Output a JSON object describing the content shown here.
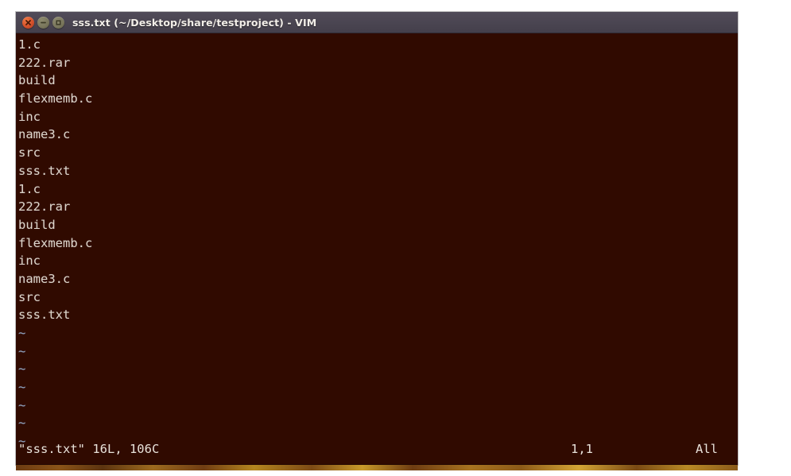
{
  "window": {
    "title": "sss.txt (~/Desktop/share/testproject) - VIM",
    "controls": [
      {
        "name": "close",
        "label": "Close",
        "color": "#d4502a"
      },
      {
        "name": "minimize",
        "label": "Minimize",
        "color": "#79765c"
      },
      {
        "name": "maximize",
        "label": "Maximize",
        "color": "#79765c"
      }
    ]
  },
  "theme": {
    "titlebar_bg": "#4a4551",
    "terminal_bg": "#300a00",
    "text_color": "#dcd4cc",
    "tilde_color": "#8fa6c6",
    "strip_color": "#b8862a"
  },
  "editor": {
    "lines": [
      "1.c",
      "222.rar",
      "build",
      "flexmemb.c",
      "inc",
      "name3.c",
      "src",
      "sss.txt",
      "1.c",
      "222.rar",
      "build",
      "flexmemb.c",
      "inc",
      "name3.c",
      "src",
      "sss.txt"
    ],
    "empty_markers": [
      "~",
      "~",
      "~",
      "~",
      "~",
      "~",
      "~"
    ]
  },
  "status": {
    "file_info": "\"sss.txt\" 16L, 106C",
    "cursor": "1,1",
    "scroll": "All"
  }
}
